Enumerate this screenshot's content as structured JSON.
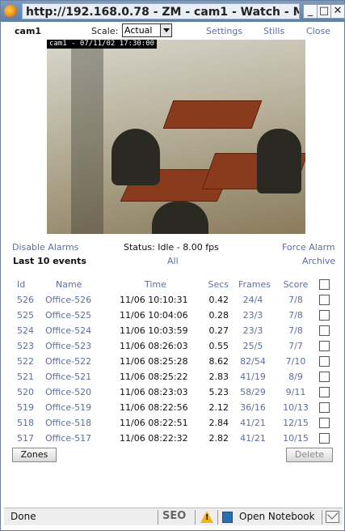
{
  "window": {
    "title": "http://192.168.0.78 - ZM - cam1 - Watch - M",
    "minimize_glyph": "_",
    "maximize_glyph": "□",
    "close_glyph": "✕"
  },
  "header": {
    "monitor_name": "cam1",
    "scale_label": "Scale:",
    "scale_value": "Actual",
    "settings_link": "Settings",
    "stills_link": "Stills",
    "close_link": "Close"
  },
  "camera": {
    "timestamp": "cam1 - 07/11/02 17:30:00"
  },
  "controls": {
    "disable_alarms": "Disable Alarms",
    "status_text": "Status: Idle - 8.00 fps",
    "force_alarm": "Force Alarm",
    "events_title": "Last 10 events",
    "all_link": "All",
    "archive_link": "Archive"
  },
  "table": {
    "headers": [
      "Id",
      "Name",
      "Time",
      "Secs",
      "Frames",
      "Score"
    ],
    "rows": [
      {
        "id": "526",
        "name": "Office-526",
        "time": "11/06 10:10:31",
        "secs": "0.42",
        "frames": "24/4",
        "score": "7/8"
      },
      {
        "id": "525",
        "name": "Office-525",
        "time": "11/06 10:04:06",
        "secs": "0.28",
        "frames": "23/3",
        "score": "7/8"
      },
      {
        "id": "524",
        "name": "Office-524",
        "time": "11/06 10:03:59",
        "secs": "0.27",
        "frames": "23/3",
        "score": "7/8"
      },
      {
        "id": "523",
        "name": "Office-523",
        "time": "11/06 08:26:03",
        "secs": "0.55",
        "frames": "25/5",
        "score": "7/7"
      },
      {
        "id": "522",
        "name": "Office-522",
        "time": "11/06 08:25:28",
        "secs": "8.62",
        "frames": "82/54",
        "score": "7/10"
      },
      {
        "id": "521",
        "name": "Office-521",
        "time": "11/06 08:25:22",
        "secs": "2.83",
        "frames": "41/19",
        "score": "8/9"
      },
      {
        "id": "520",
        "name": "Office-520",
        "time": "11/06 08:23:03",
        "secs": "5.23",
        "frames": "58/29",
        "score": "9/11"
      },
      {
        "id": "519",
        "name": "Office-519",
        "time": "11/06 08:22:56",
        "secs": "2.12",
        "frames": "36/16",
        "score": "10/13"
      },
      {
        "id": "518",
        "name": "Office-518",
        "time": "11/06 08:22:51",
        "secs": "2.84",
        "frames": "41/21",
        "score": "12/15"
      },
      {
        "id": "517",
        "name": "Office-517",
        "time": "11/06 08:22:32",
        "secs": "2.82",
        "frames": "41/21",
        "score": "10/15"
      }
    ]
  },
  "buttons": {
    "zones": "Zones",
    "delete": "Delete"
  },
  "statusbar": {
    "done": "Done",
    "seo_text": "SEO",
    "warning_mark": "!",
    "notebook": "Open Notebook"
  },
  "colors": {
    "link": "#5c6fa0",
    "titlebar": "#5d7ea6"
  }
}
